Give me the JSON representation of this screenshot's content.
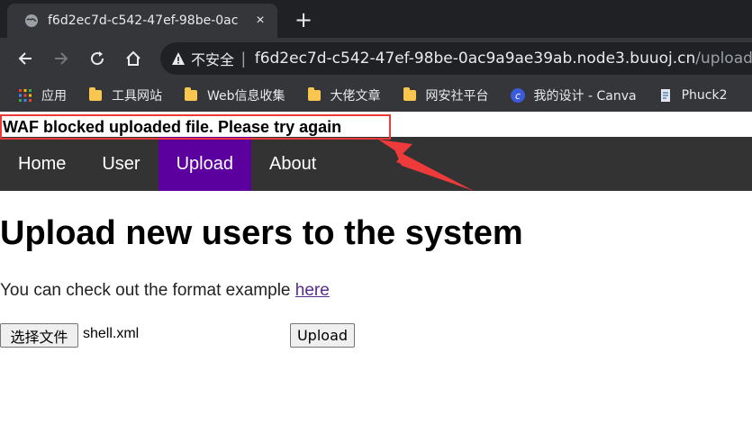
{
  "browser": {
    "tab_title": "f6d2ec7d-c542-47ef-98be-0ac",
    "tab_close": "×",
    "new_tab": "+",
    "insecure_label": "不安全",
    "separator": "|",
    "url_host": "f6d2ec7d-c542-47ef-98be-0ac9a9ae39ab.node3.buuoj.cn",
    "url_path": "/upload"
  },
  "bookmarks": [
    {
      "label": "应用",
      "icon": "apps-grid-icon"
    },
    {
      "label": "工具网站",
      "icon": "folder-icon"
    },
    {
      "label": "Web信息收集",
      "icon": "folder-icon"
    },
    {
      "label": "大佬文章",
      "icon": "folder-icon"
    },
    {
      "label": "网安社平台",
      "icon": "folder-icon"
    },
    {
      "label": "我的设计 - Canva",
      "icon": "canva-icon"
    },
    {
      "label": "Phuck2",
      "icon": "bookmark-page-icon"
    }
  ],
  "page": {
    "waf_message": "WAF blocked uploaded file. Please try again",
    "nav": {
      "items": [
        "Home",
        "User",
        "Upload",
        "About"
      ],
      "active": "Upload"
    },
    "heading": "Upload new users to the system",
    "note_text": "You can check out the format example ",
    "note_link": "here",
    "choose_file_label": "选择文件",
    "file_name": "shell.xml",
    "upload_label": "Upload"
  },
  "colors": {
    "nav_bg": "#333333",
    "nav_active": "#5b009f",
    "annotation_red": "#ee3a3a"
  }
}
